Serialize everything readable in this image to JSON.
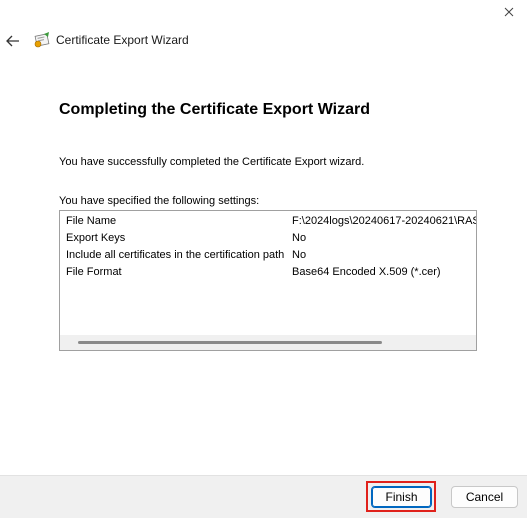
{
  "window": {
    "title": "Certificate Export Wizard",
    "close_icon": "close-icon",
    "back_icon": "back-arrow-icon",
    "app_icon": "certificate-icon"
  },
  "main": {
    "heading": "Completing the Certificate Export Wizard",
    "success_text": "You have successfully completed the Certificate Export wizard.",
    "settings_label": "You have specified the following settings:",
    "settings": [
      {
        "key": "File Name",
        "value": "F:\\2024logs\\20240617-20240621\\RAS"
      },
      {
        "key": "Export Keys",
        "value": "No"
      },
      {
        "key": "Include all certificates in the certification path",
        "value": "No"
      },
      {
        "key": "File Format",
        "value": "Base64 Encoded X.509 (*.cer)"
      }
    ]
  },
  "footer": {
    "finish_label": "Finish",
    "cancel_label": "Cancel"
  },
  "colors": {
    "highlight": "#e0211b",
    "accent": "#0067c0",
    "footer_bg": "#f0f0f0"
  }
}
